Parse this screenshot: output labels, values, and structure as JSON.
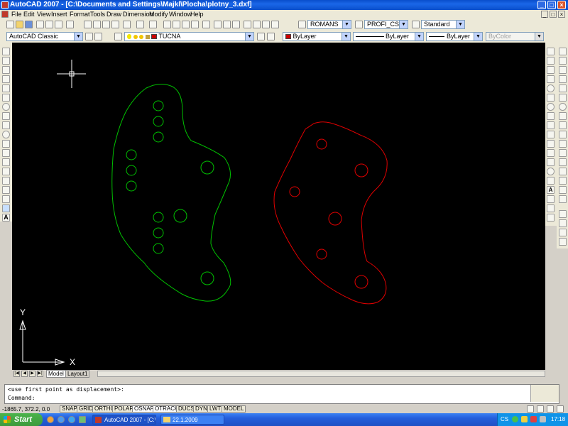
{
  "window": {
    "title": "AutoCAD 2007 - [C:\\Documents and Settings\\Majkl\\Plocha\\plotny_3.dxf]",
    "minimize_icon": "minimize-icon",
    "maximize_icon": "maximize-icon",
    "close_icon": "close-icon"
  },
  "menu": {
    "items": [
      "File",
      "Edit",
      "View",
      "Insert",
      "Format",
      "Tools",
      "Draw",
      "Dimension",
      "Modify",
      "Window",
      "Help"
    ]
  },
  "styles_toolbar": {
    "text_style": "ROMANS",
    "dim_style": "PROFI_CSN",
    "table_style": "Standard"
  },
  "workspace": {
    "name": "AutoCAD Classic"
  },
  "layers": {
    "current_layer": "TUCNA",
    "layer_color": "#cc0000"
  },
  "properties": {
    "color": "ByLayer",
    "color_swatch": "#cc0000",
    "linetype": "ByLayer",
    "lineweight": "ByLayer",
    "plot_style": "ByColor"
  },
  "drawing": {
    "left_part_color": "#00c000",
    "right_part_color": "#e00000",
    "ucs_x_label": "X",
    "ucs_y_label": "Y"
  },
  "layout_tabs": [
    "Model",
    "Layout1"
  ],
  "command": {
    "history": "<use first point as displacement>:",
    "prompt": "Command:"
  },
  "status": {
    "coordinates": "-1865.7, 372.2, 0.0",
    "toggles": [
      "SNAP",
      "GRID",
      "ORTHO",
      "POLAR",
      "OSNAP",
      "OTRACK",
      "DUCS",
      "DYN",
      "LWT",
      "MODEL"
    ]
  },
  "taskbar": {
    "start_label": "Start",
    "tasks": [
      "AutoCAD 2007 - [C:\\...",
      "22.1.2009"
    ],
    "language": "CS",
    "clock": "17:18"
  }
}
